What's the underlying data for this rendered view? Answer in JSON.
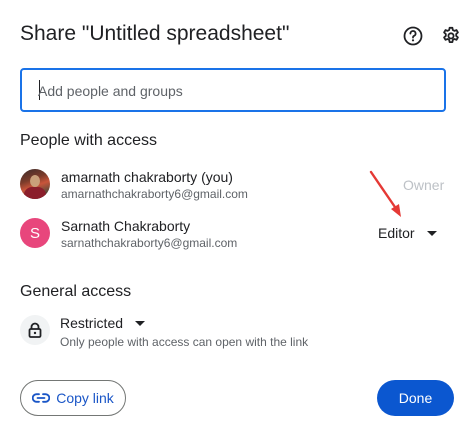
{
  "dialog": {
    "title": "Share \"Untitled spreadsheet\""
  },
  "header": {
    "help_icon": "help-circle-icon",
    "settings_icon": "gear-icon"
  },
  "add_people": {
    "placeholder": "Add people and groups",
    "value": ""
  },
  "people_section": {
    "heading": "People with access",
    "people": [
      {
        "name": "amarnath chakraborty (you)",
        "email": "amarnathchakraborty6@gmail.com",
        "role": "Owner",
        "avatar": "photo"
      },
      {
        "name": "Sarnath Chakraborty",
        "email": "sarnathchakraborty6@gmail.com",
        "role": "Editor",
        "avatar_letter": "S",
        "avatar_color": "#e8467c"
      }
    ]
  },
  "general_access": {
    "heading": "General access",
    "level": "Restricted",
    "description": "Only people with access can open with the link",
    "icon": "lock-icon"
  },
  "footer": {
    "copy_link_label": "Copy link",
    "done_label": "Done"
  },
  "colors": {
    "accent": "#0b57d0",
    "focus_border": "#1a73e8",
    "annotation_arrow": "#e53935"
  }
}
